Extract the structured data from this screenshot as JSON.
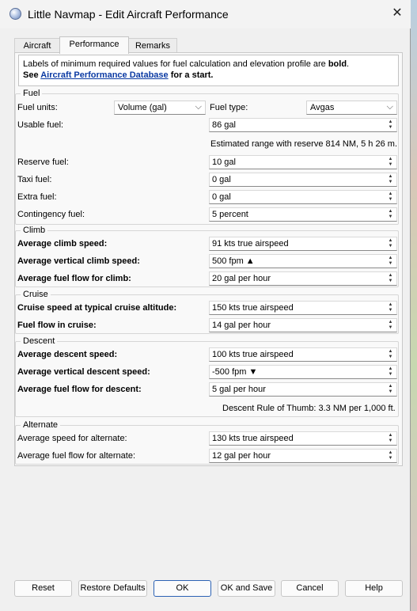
{
  "window": {
    "title": "Little Navmap - Edit Aircraft Performance",
    "close": "✕"
  },
  "tabs": [
    {
      "label": "Aircraft"
    },
    {
      "label": "Performance"
    },
    {
      "label": "Remarks"
    }
  ],
  "info": {
    "line1_pre": "Labels of minimum required values for fuel calculation and elevation profile are ",
    "line1_bold": "bold",
    "line1_end": ".",
    "line2_pre": "See ",
    "line2_link": "Aircraft Performance Database",
    "line2_post": " for a start."
  },
  "fuel": {
    "title": "Fuel",
    "units_label": "Fuel units:",
    "units_value": "Volume (gal)",
    "type_label": "Fuel type:",
    "type_value": "Avgas",
    "usable_label": "Usable fuel:",
    "usable_value": "86 gal",
    "range_note": "Estimated range with reserve 814 NM, 5 h 26 m.",
    "reserve_label": "Reserve fuel:",
    "reserve_value": "10 gal",
    "taxi_label": "Taxi fuel:",
    "taxi_value": "0 gal",
    "extra_label": "Extra fuel:",
    "extra_value": "0 gal",
    "contingency_label": "Contingency fuel:",
    "contingency_value": "5 percent"
  },
  "climb": {
    "title": "Climb",
    "speed_label": "Average climb speed:",
    "speed_value": "91 kts true airspeed",
    "vs_label": "Average vertical climb speed:",
    "vs_value": "500 fpm ▲",
    "ff_label": "Average fuel flow for climb:",
    "ff_value": "20 gal per hour"
  },
  "cruise": {
    "title": "Cruise",
    "speed_label": "Cruise speed at typical cruise altitude:",
    "speed_value": "150 kts true airspeed",
    "ff_label": "Fuel flow in cruise:",
    "ff_value": "14 gal per hour"
  },
  "descent": {
    "title": "Descent",
    "speed_label": "Average descent speed:",
    "speed_value": "100 kts true airspeed",
    "vs_label": "Average vertical descent speed:",
    "vs_value": "-500 fpm ▼",
    "ff_label": "Average fuel flow for descent:",
    "ff_value": "5 gal per hour",
    "rule_note": "Descent Rule of Thumb: 3.3 NM per 1,000 ft."
  },
  "alternate": {
    "title": "Alternate",
    "speed_label": "Average speed for alternate:",
    "speed_value": "130 kts true airspeed",
    "ff_label": "Average fuel flow for alternate:",
    "ff_value": "12 gal per hour"
  },
  "buttons": {
    "reset": "Reset",
    "restore": "Restore Defaults",
    "ok": "OK",
    "ok_save": "OK and Save",
    "cancel": "Cancel",
    "help": "Help"
  },
  "icons": {
    "spin_up": "▲",
    "spin_down": "▼",
    "dropdown": "⌵"
  }
}
